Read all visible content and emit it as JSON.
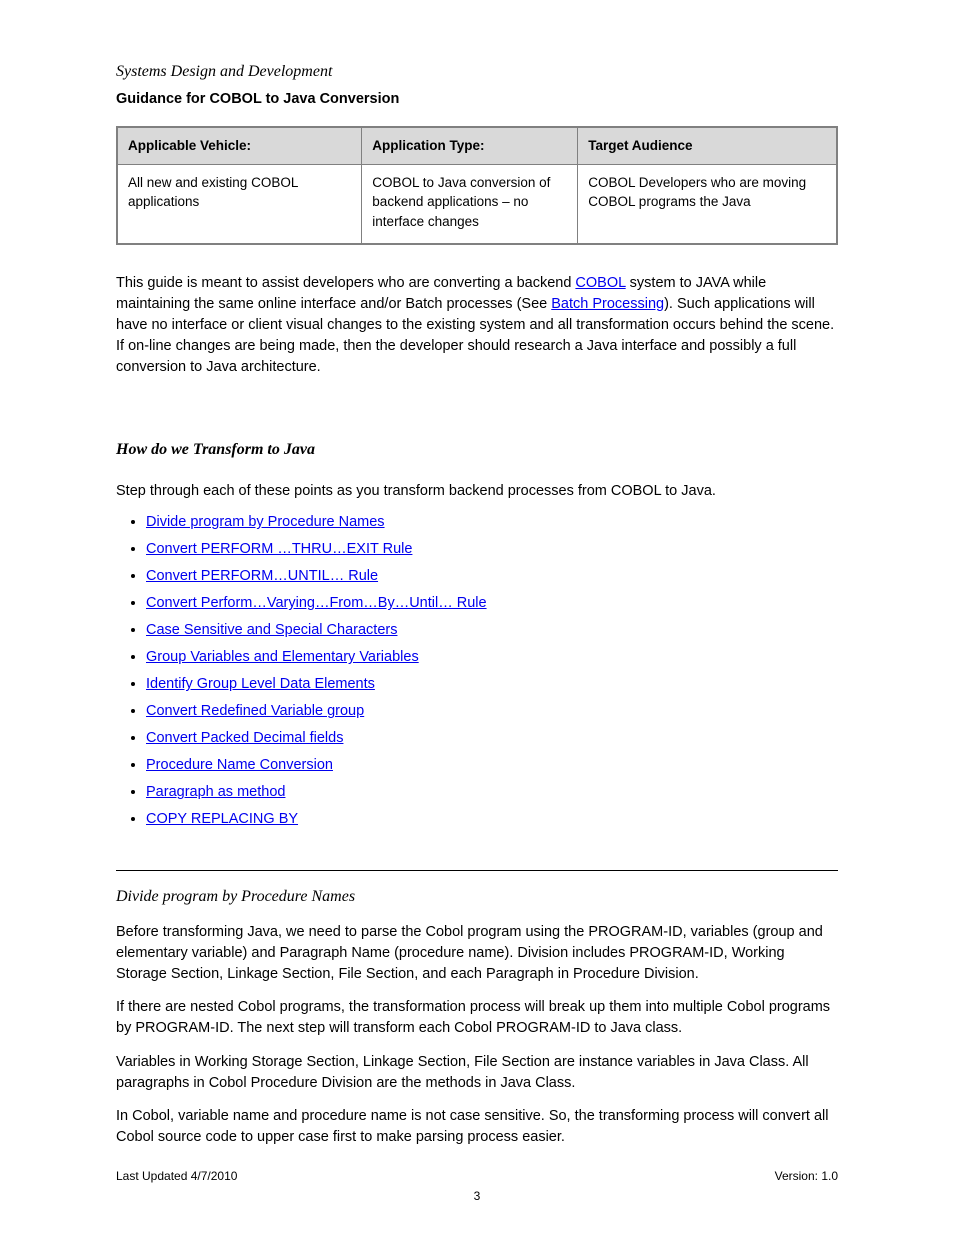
{
  "title": "Systems Design and Development",
  "subtitle": "Guidance for COBOL to Java Conversion",
  "table": {
    "headers": [
      "Applicable Vehicle:",
      "Application Type:",
      "Target Audience"
    ],
    "row": [
      "All new and existing COBOL applications",
      "COBOL to Java conversion of backend applications – no interface changes",
      "COBOL Developers who are moving COBOL programs the Java"
    ]
  },
  "intro": {
    "text_before_link1": "This guide is meant to assist developers who are converting a backend ",
    "link1": "COBOL",
    "text_mid": " system to JAVA while maintaining the same online interface and/or Batch processes (See ",
    "link2": "Batch Processing",
    "text_end": ").  Such applications will have no interface or client visual changes to the existing system and all transformation occurs behind the scene.   If on-line changes are being made, then the developer should research a Java interface and possibly a full conversion to Java architecture."
  },
  "transform_heading": "How do we Transform to Java",
  "steps_intro": "Step through each of these points as you transform backend processes from COBOL to Java.",
  "steps": [
    "Divide program by Procedure Names",
    "Convert PERFORM …THRU…EXIT Rule",
    "Convert PERFORM…UNTIL… Rule",
    "Convert Perform…Varying…From…By…Until… Rule",
    "Case Sensitive and Special Characters",
    "Group Variables and Elementary Variables",
    "Identify Group Level Data Elements",
    "Convert Redefined Variable group",
    "Convert Packed Decimal fields",
    "Procedure Name Conversion",
    "Paragraph as method",
    "COPY REPLACING BY"
  ],
  "section_heading": "Divide program by Procedure Names",
  "body": [
    "Before transforming Java, we need to parse the Cobol program using the PROGRAM-ID, variables (group and elementary variable) and Paragraph Name (procedure name). Division includes PROGRAM-ID, Working Storage Section, Linkage Section, File Section, and each Paragraph in Procedure Division.",
    "If there are nested Cobol programs, the transformation process will break up them into multiple Cobol programs by PROGRAM-ID. The next step will transform each Cobol PROGRAM-ID to Java class.",
    "Variables in Working Storage Section, Linkage Section, File Section are instance variables in Java Class. All paragraphs in Cobol Procedure Division are the methods in Java Class.",
    "In Cobol, variable name and procedure name is not case sensitive. So, the transforming process will convert all Cobol source code to upper case first to make parsing process easier."
  ],
  "footer_left": "Last Updated 4/7/2010",
  "footer_right": "Version: 1.0",
  "page_number": "3"
}
